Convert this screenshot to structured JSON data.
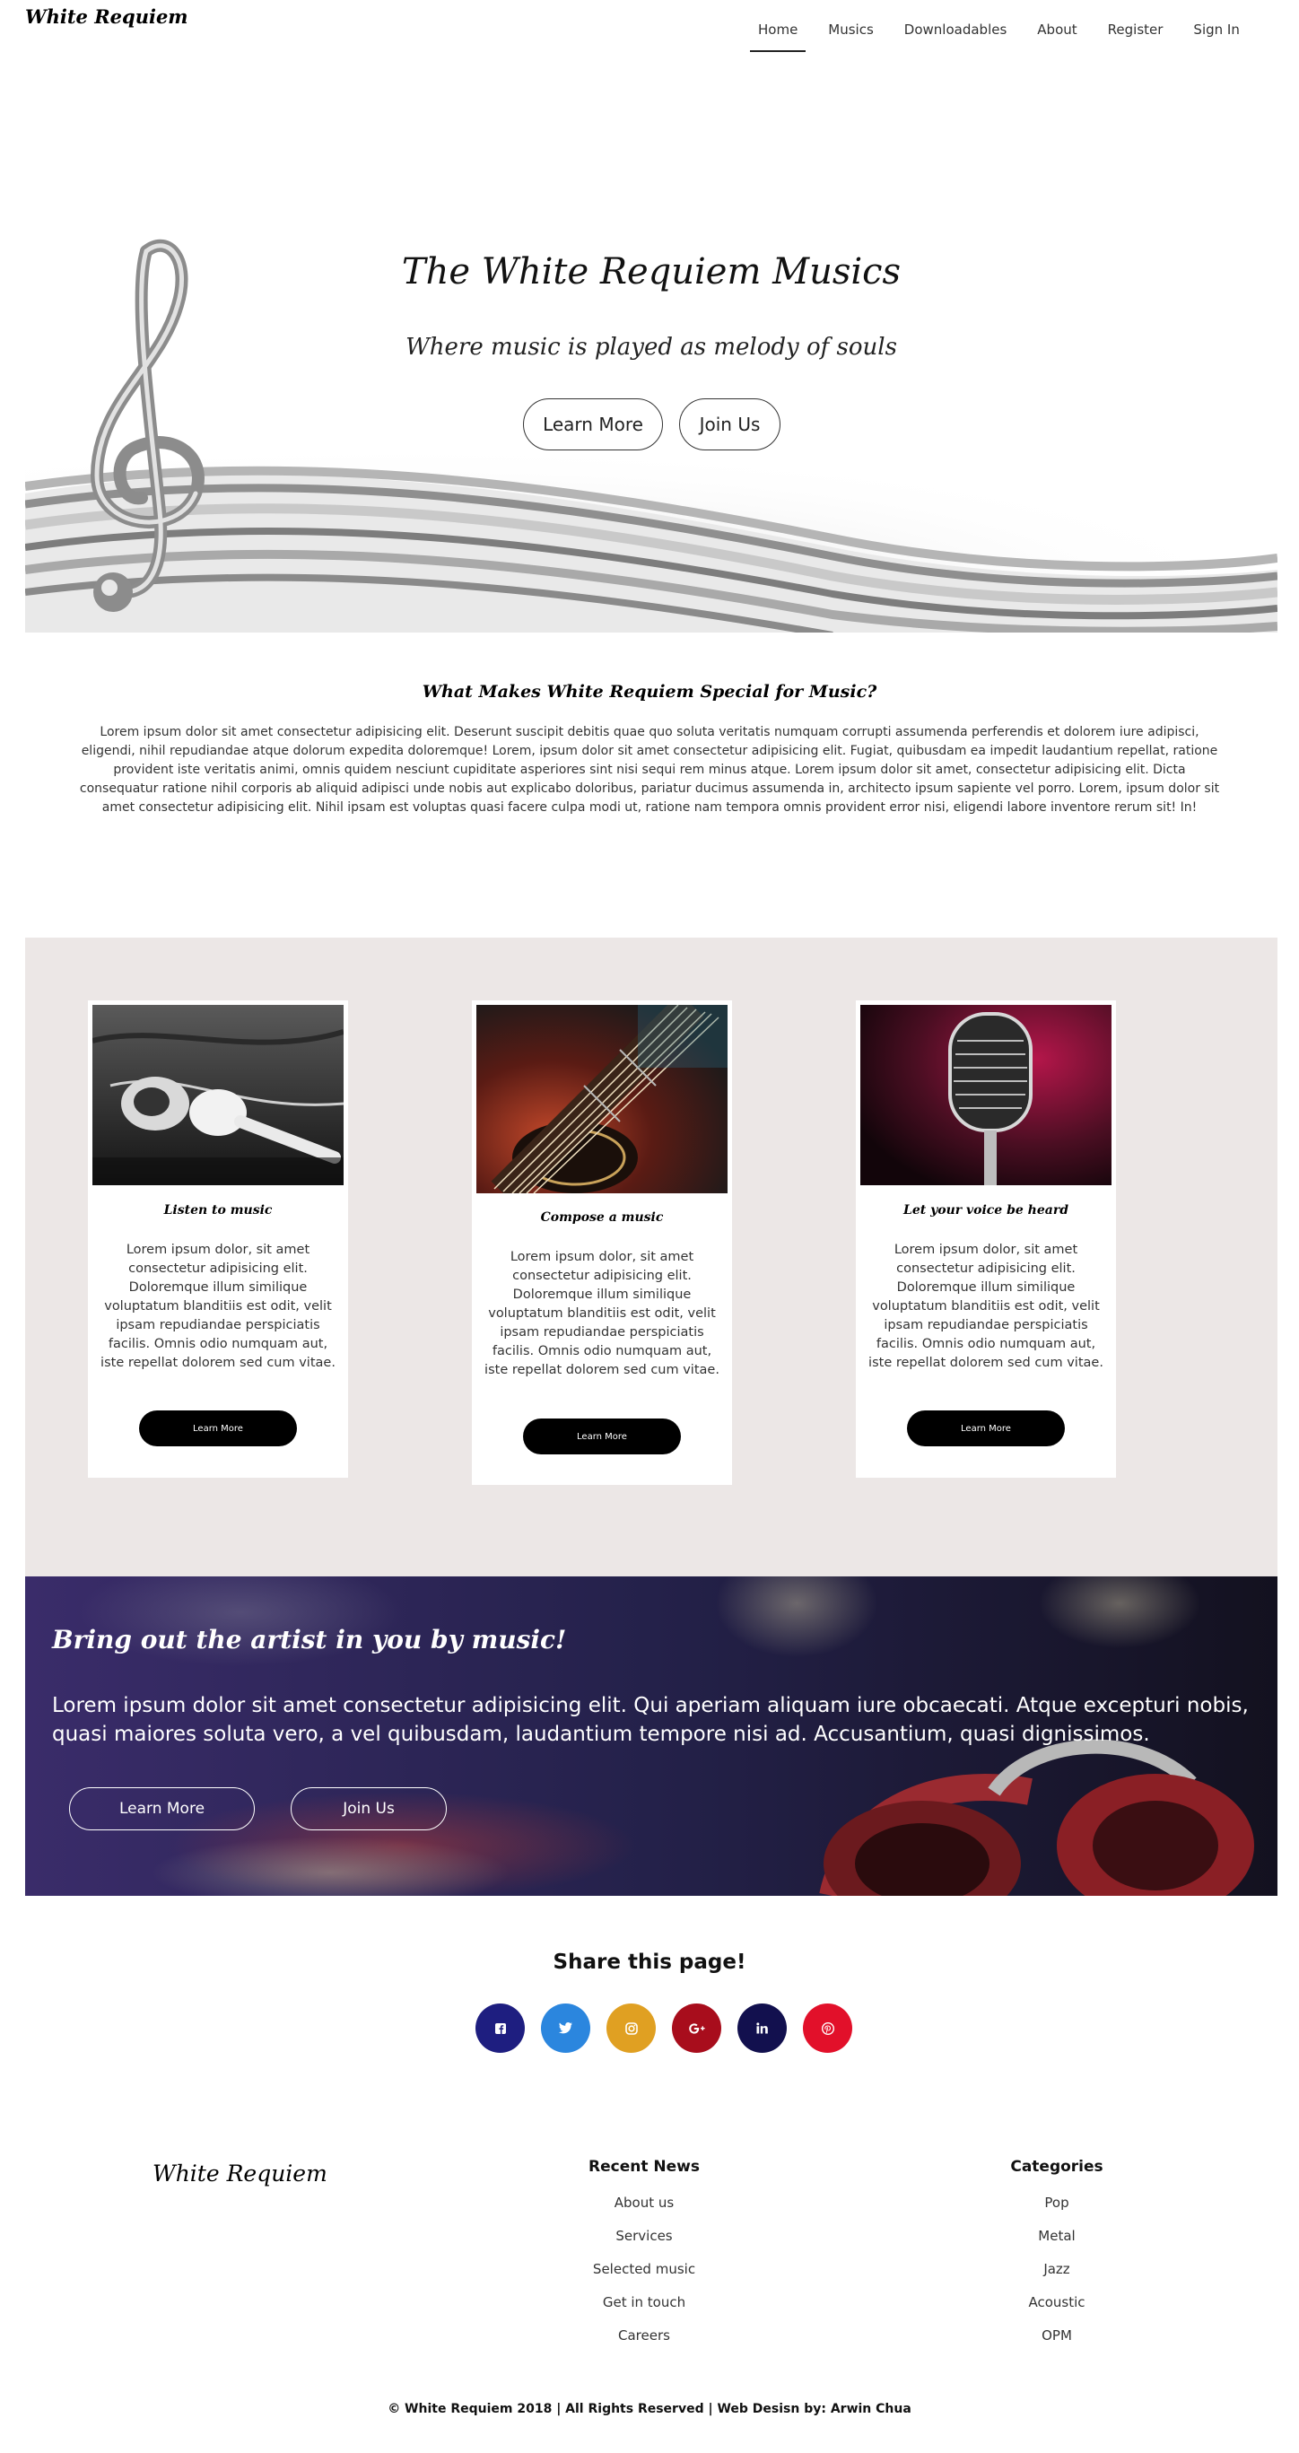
{
  "nav": {
    "brand": "White Requiem",
    "links": [
      "Home",
      "Musics",
      "Downloadables",
      "About",
      "Register",
      "Sign In"
    ]
  },
  "hero": {
    "title": "The White Requiem Musics",
    "subtitle": "Where music is played as melody of souls",
    "learn_label": "Learn More",
    "join_label": "Join Us"
  },
  "special": {
    "title": "What Makes White Requiem Special for Music?",
    "body": "Lorem ipsum dolor sit amet consectetur adipisicing elit. Deserunt suscipit debitis quae quo soluta veritatis numquam corrupti assumenda perferendis et dolorem iure adipisci, eligendi, nihil repudiandae atque dolorum expedita doloremque! Lorem, ipsum dolor sit amet consectetur adipisicing elit. Fugiat, quibusdam ea impedit laudantium repellat, ratione provident iste veritatis animi, omnis quidem nesciunt cupiditate asperiores sint nisi sequi rem minus atque. Lorem ipsum dolor sit amet, consectetur adipisicing elit. Dicta consequatur ratione nihil corporis ab aliquid adipisci unde nobis aut explicabo doloribus, pariatur ducimus assumenda in, architecto ipsum sapiente vel porro. Lorem, ipsum dolor sit amet consectetur adipisicing elit. Nihil ipsam est voluptas quasi facere culpa modi ut, ratione nam tempora omnis provident error nisi, eligendi labore inventore rerum sit! In!"
  },
  "cards": [
    {
      "title": "Listen to music",
      "text": "Lorem ipsum dolor, sit amet consectetur adipisicing elit. Doloremque illum similique voluptatum blanditiis est odit, velit ipsam repudiandae perspiciatis facilis. Omnis odio numquam aut, iste repellat dolorem sed cum vitae.",
      "button": "Learn More",
      "image": "earphones-photo"
    },
    {
      "title": "Compose a music",
      "text": "Lorem ipsum dolor, sit amet consectetur adipisicing elit. Doloremque illum similique voluptatum blanditiis est odit, velit ipsam repudiandae perspiciatis facilis. Omnis odio numquam aut, iste repellat dolorem sed cum vitae.",
      "button": "Learn More",
      "image": "guitar-photo"
    },
    {
      "title": "Let your voice be heard",
      "text": "Lorem ipsum dolor, sit amet consectetur adipisicing elit. Doloremque illum similique voluptatum blanditiis est odit, velit ipsam repudiandae perspiciatis facilis. Omnis odio numquam aut, iste repellat dolorem sed cum vitae.",
      "button": "Learn More",
      "image": "microphone-photo"
    }
  ],
  "artist": {
    "title": "Bring out the artist in you by music!",
    "body": "Lorem ipsum dolor sit amet consectetur adipisicing elit. Qui aperiam aliquam iure obcaecati. Atque excepturi nobis, quasi maiores soluta vero, a vel quibusdam, laudantium tempore nisi ad. Accusantium, quasi dignissimos.",
    "learn_label": "Learn More",
    "join_label": "Join Us"
  },
  "share": {
    "title": "Share this page!",
    "icons": [
      {
        "name": "facebook-icon",
        "color": "#1e1e80"
      },
      {
        "name": "twitter-icon",
        "color": "#2b86de"
      },
      {
        "name": "instagram-icon",
        "color": "#e0a022"
      },
      {
        "name": "google-plus-icon",
        "color": "#a80d1c"
      },
      {
        "name": "linkedin-icon",
        "color": "#12104e"
      },
      {
        "name": "pinterest-icon",
        "color": "#e2102a"
      }
    ]
  },
  "footer": {
    "brand": "White Requiem",
    "recent_title": "Recent News",
    "recent_links": [
      "About us",
      "Services",
      "Selected music",
      "Get in touch",
      "Careers"
    ],
    "categories_title": "Categories",
    "category_links": [
      "Pop",
      "Metal",
      "Jazz",
      "Acoustic",
      "OPM"
    ],
    "copyright": "© White Requiem 2018 | All Rights Reserved | Web Desisn by: Arwin Chua"
  }
}
